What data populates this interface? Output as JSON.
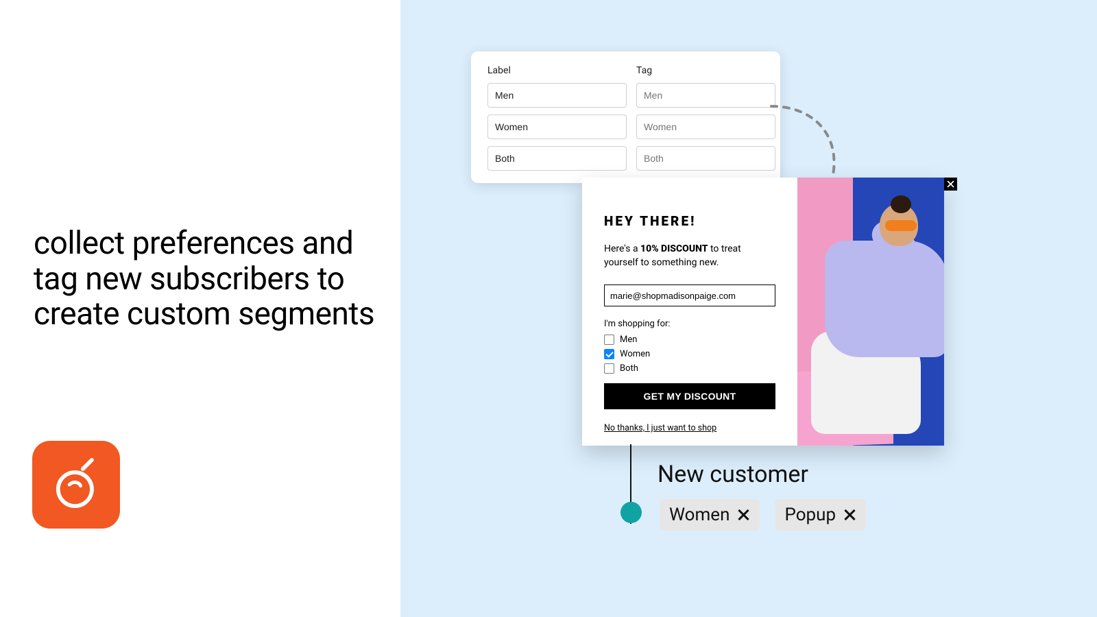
{
  "headline": "collect preferences and tag new subscribers to create custom segments",
  "labeltag": {
    "label_header": "Label",
    "tag_header": "Tag",
    "rows": [
      {
        "label": "Men",
        "tag": "Men"
      },
      {
        "label": "Women",
        "tag": "Women"
      },
      {
        "label": "Both",
        "tag": "Both"
      }
    ]
  },
  "popup": {
    "title": "HEY THERE!",
    "sub_pre": "Here's a ",
    "sub_bold": "10% DISCOUNT",
    "sub_post": " to treat yourself to something new.",
    "email": "marie@shopmadisonpaige.com",
    "shopping_for_label": "I'm shopping for:",
    "options": [
      {
        "label": "Men",
        "checked": false
      },
      {
        "label": "Women",
        "checked": true
      },
      {
        "label": "Both",
        "checked": false
      }
    ],
    "cta": "GET MY DISCOUNT",
    "dismiss": "No thanks, I just want to shop"
  },
  "flow": {
    "title": "New customer",
    "chips": [
      "Women",
      "Popup"
    ]
  }
}
